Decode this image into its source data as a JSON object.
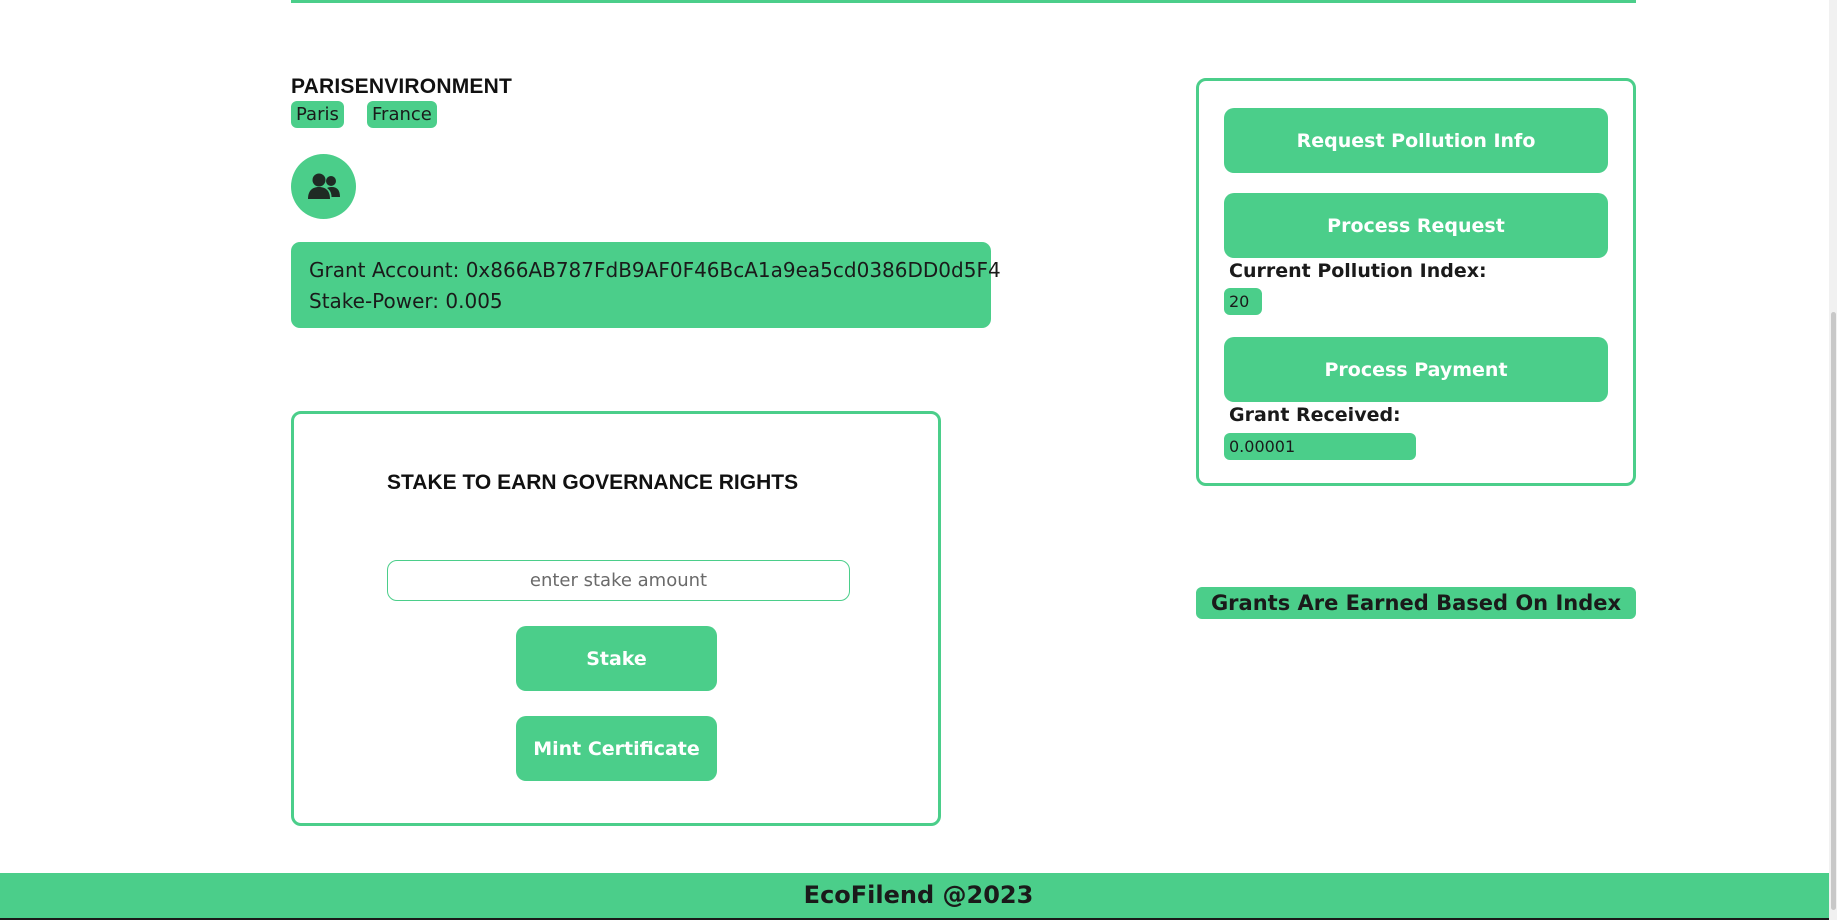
{
  "colors": {
    "accent": "#4bce8a",
    "text": "#1a1a1a",
    "button_text": "#ffffff"
  },
  "profile": {
    "title": "PARISENVIRONMENT",
    "city": "Paris",
    "country": "France",
    "avatar_icon": "users-icon"
  },
  "grant": {
    "account_line": "Grant Account: 0x866AB787FdB9AF0F46BcA1a9ea5cd0386DD0d5F4",
    "stake_power_line": "Stake-Power: 0.005"
  },
  "stake": {
    "title": "STAKE TO EARN GOVERNANCE RIGHTS",
    "input_placeholder": "enter stake amount",
    "stake_label": "Stake",
    "mint_label": "Mint Certificate"
  },
  "oracle": {
    "request_label": "Request Pollution Info",
    "process_label": "Process Request",
    "index_label": "Current Pollution Index:",
    "index_value": "20",
    "payment_label": "Process Payment",
    "grant_label": "Grant Received:",
    "grant_value": "0.00001"
  },
  "info": {
    "banner": "Grants Are Earned Based On Index"
  },
  "footer": {
    "text": "EcoFilend @2023"
  }
}
